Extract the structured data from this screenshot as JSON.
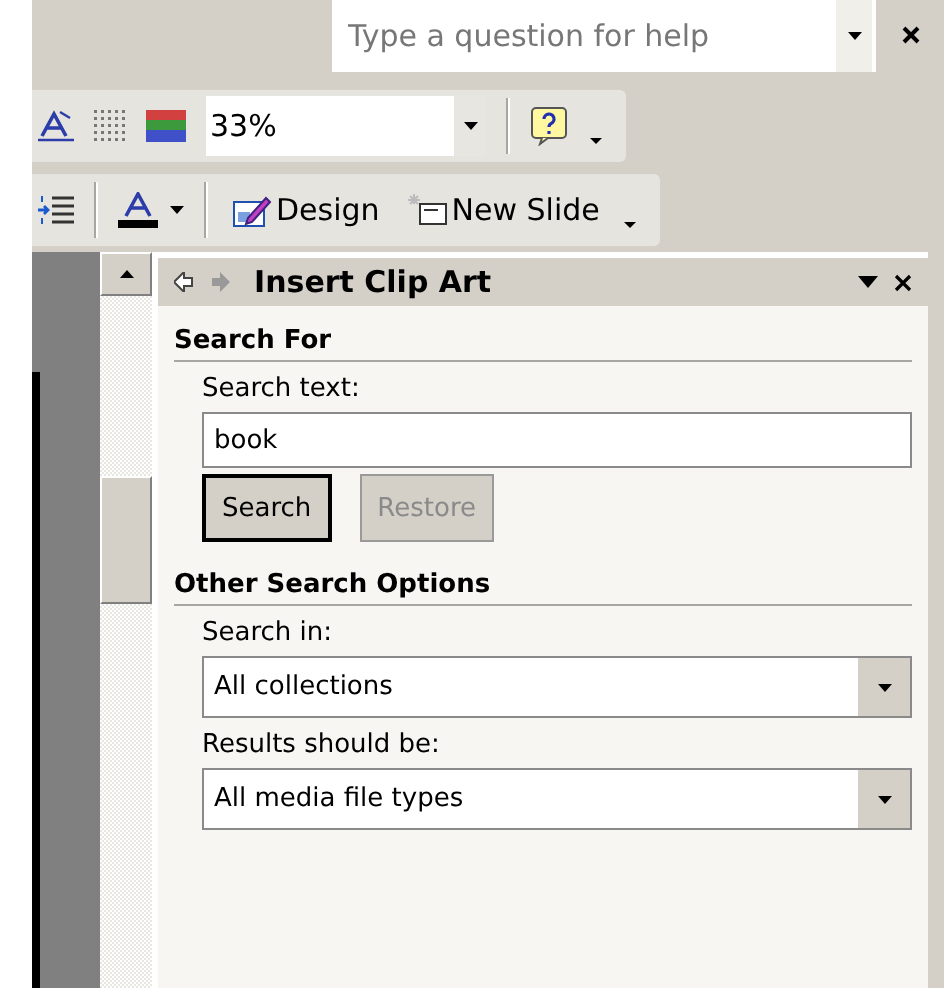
{
  "help_box": {
    "placeholder": "Type a question for help"
  },
  "formatting_toolbar": {
    "zoom": "33%"
  },
  "drawing_toolbar": {
    "buttons": [
      {
        "kind": "design",
        "label": "Design"
      },
      {
        "kind": "new-slide",
        "label": "New Slide"
      }
    ]
  },
  "task_pane": {
    "title": "Insert Clip Art",
    "sections": [
      {
        "heading": "Search For",
        "fields": [
          {
            "kind": "text",
            "label": "Search text:",
            "value": "book"
          }
        ],
        "buttons": [
          {
            "label": "Search",
            "default": true,
            "disabled": false
          },
          {
            "label": "Restore",
            "default": false,
            "disabled": true
          }
        ]
      },
      {
        "heading": "Other Search Options",
        "fields": [
          {
            "kind": "dropdown",
            "label": "Search in:",
            "value": "All collections"
          },
          {
            "kind": "dropdown",
            "label": "Results should be:",
            "value": "All media file types"
          }
        ]
      }
    ]
  }
}
